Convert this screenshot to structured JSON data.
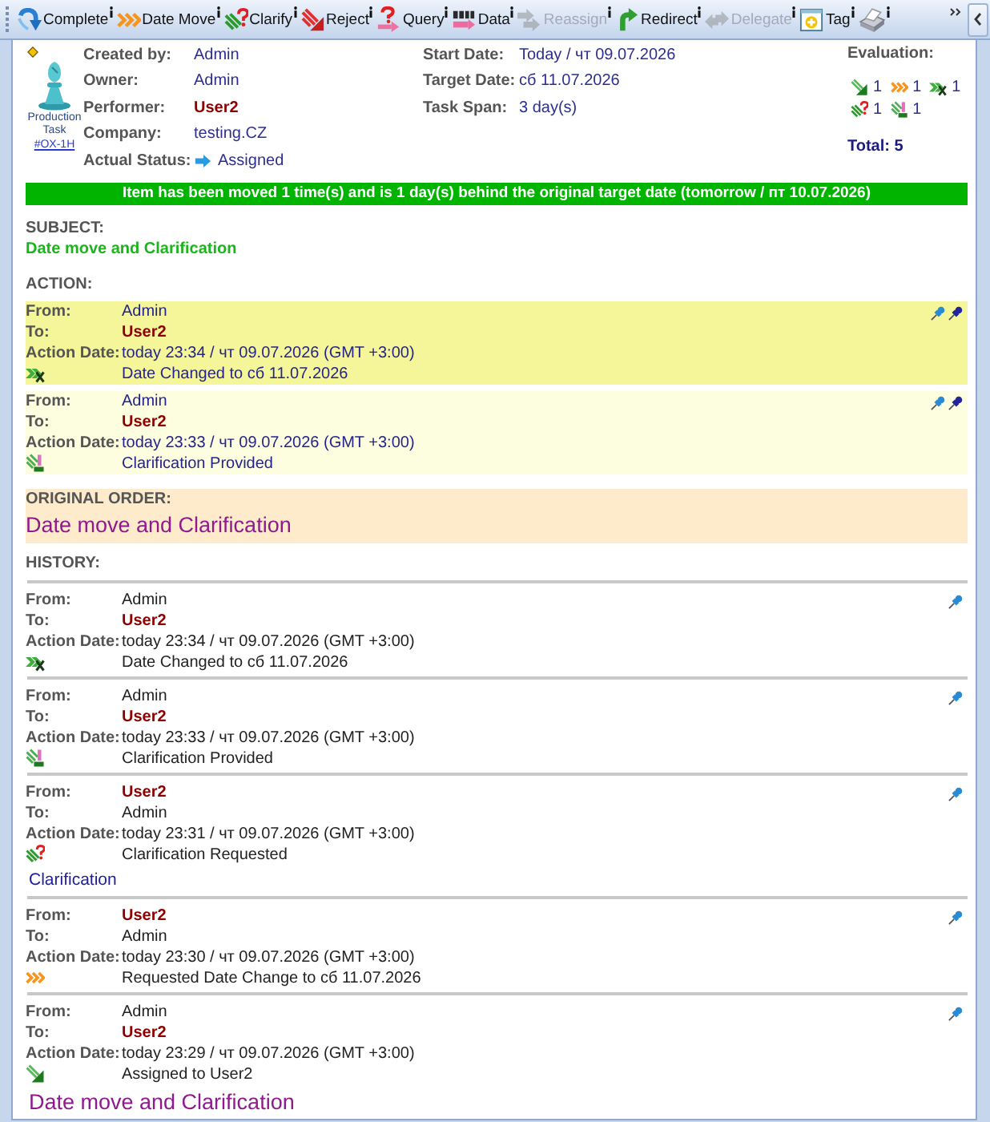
{
  "toolbar": {
    "buttons": [
      {
        "kind": "complete",
        "label": "Complete",
        "disabled": false
      },
      {
        "kind": "date_move",
        "label": "Date Move",
        "disabled": false
      },
      {
        "kind": "clarify",
        "label": "Clarify",
        "disabled": false
      },
      {
        "kind": "reject",
        "label": "Reject",
        "disabled": false
      },
      {
        "kind": "query",
        "label": "Query",
        "disabled": false
      },
      {
        "kind": "data",
        "label": "Data",
        "disabled": false
      },
      {
        "kind": "reassign",
        "label": "Reassign",
        "disabled": true
      },
      {
        "kind": "redirect",
        "label": "Redirect",
        "disabled": false
      },
      {
        "kind": "delegate",
        "label": "Delegate",
        "disabled": true
      },
      {
        "kind": "tag",
        "label": "Tag",
        "disabled": false
      },
      {
        "kind": "print",
        "disabled": false
      }
    ]
  },
  "task": {
    "type": "Production Task",
    "code": "#OX-1H"
  },
  "details": [
    {
      "label": "Created by:",
      "value": "Admin",
      "performer": false,
      "kind": "text"
    },
    {
      "label": "Owner:",
      "value": "Admin",
      "performer": false,
      "kind": "text"
    },
    {
      "label": "Performer:",
      "value": "User2",
      "performer": true,
      "kind": "text"
    },
    {
      "label": "Company:",
      "value": "testing.CZ",
      "performer": false,
      "kind": "text"
    },
    {
      "label": "Actual Status:",
      "value": "Assigned",
      "performer": false,
      "kind": "status"
    }
  ],
  "dates": [
    {
      "label": "Start Date:",
      "value": "Today / чт 09.07.2026"
    },
    {
      "label": "Target Date:",
      "value": "сб 11.07.2026"
    },
    {
      "label": "Task Span:",
      "value": "3 day(s)"
    }
  ],
  "evaluation": {
    "label": "Evaluation:",
    "items": [
      {
        "kind": "assigned",
        "count": "1"
      },
      {
        "kind": "date_request",
        "count": "1"
      },
      {
        "kind": "date_changed",
        "count": "1"
      },
      {
        "kind": "clarify_request",
        "count": "1"
      },
      {
        "kind": "clarify_provided",
        "count": "1"
      }
    ],
    "total": "Total: 5"
  },
  "banner": "Item has been moved 1 time(s) and is 1 day(s) behind the original target date (tomorrow / пт 10.07.2026)",
  "subject": {
    "label": "SUBJECT:",
    "text": "Date move and Clarification"
  },
  "action": {
    "label": "ACTION:",
    "entries": [
      {
        "selected": true,
        "fields": [
          {
            "label": "From:",
            "value": "Admin",
            "performer": false
          },
          {
            "label": "To:",
            "value": "User2",
            "performer": true
          },
          {
            "label": "Action Date:",
            "value": "today 23:34 / чт 09.07.2026 (GMT +3:00)",
            "performer": false
          }
        ],
        "kind": "date_changed",
        "text": "Date Changed to сб 11.07.2026"
      },
      {
        "selected": false,
        "fields": [
          {
            "label": "From:",
            "value": "Admin",
            "performer": false
          },
          {
            "label": "To:",
            "value": "User2",
            "performer": true
          },
          {
            "label": "Action Date:",
            "value": "today 23:33 / чт 09.07.2026 (GMT +3:00)",
            "performer": false
          }
        ],
        "kind": "clarify_provided",
        "text": "Clarification Provided"
      }
    ]
  },
  "original_order": {
    "label": "ORIGINAL ORDER:",
    "text": "Date move and Clarification"
  },
  "history": {
    "label": "HISTORY:",
    "entries": [
      {
        "fields": [
          {
            "label": "From:",
            "value": "Admin",
            "performer": false
          },
          {
            "label": "To:",
            "value": "User2",
            "performer": true
          },
          {
            "label": "Action Date:",
            "value": "today 23:34 / чт 09.07.2026 (GMT +3:00)",
            "performer": false
          }
        ],
        "kind": "date_changed",
        "text": "Date Changed to сб 11.07.2026"
      },
      {
        "fields": [
          {
            "label": "From:",
            "value": "Admin",
            "performer": false
          },
          {
            "label": "To:",
            "value": "User2",
            "performer": true
          },
          {
            "label": "Action Date:",
            "value": "today 23:33 / чт 09.07.2026 (GMT +3:00)",
            "performer": false
          }
        ],
        "kind": "clarify_provided",
        "text": "Clarification Provided"
      },
      {
        "fields": [
          {
            "label": "From:",
            "value": "User2",
            "performer": true
          },
          {
            "label": "To:",
            "value": "Admin",
            "performer": false
          },
          {
            "label": "Action Date:",
            "value": "today 23:31 / чт 09.07.2026 (GMT +3:00)",
            "performer": false
          }
        ],
        "kind": "clarify_request",
        "text": "Clarification Requested",
        "note": {
          "kind": "comment",
          "text": "Clarification"
        }
      },
      {
        "fields": [
          {
            "label": "From:",
            "value": "User2",
            "performer": true
          },
          {
            "label": "To:",
            "value": "Admin",
            "performer": false
          },
          {
            "label": "Action Date:",
            "value": "today 23:30 / чт 09.07.2026 (GMT +3:00)",
            "performer": false
          }
        ],
        "kind": "date_request",
        "text": "Requested Date Change to сб 11.07.2026"
      },
      {
        "fields": [
          {
            "label": "From:",
            "value": "Admin",
            "performer": false
          },
          {
            "label": "To:",
            "value": "User2",
            "performer": true
          },
          {
            "label": "Action Date:",
            "value": "today 23:29 / чт 09.07.2026 (GMT +3:00)",
            "performer": false
          }
        ],
        "kind": "assigned",
        "text": "Assigned to User2",
        "note": {
          "kind": "order",
          "text": "Date move and Clarification"
        }
      }
    ]
  }
}
